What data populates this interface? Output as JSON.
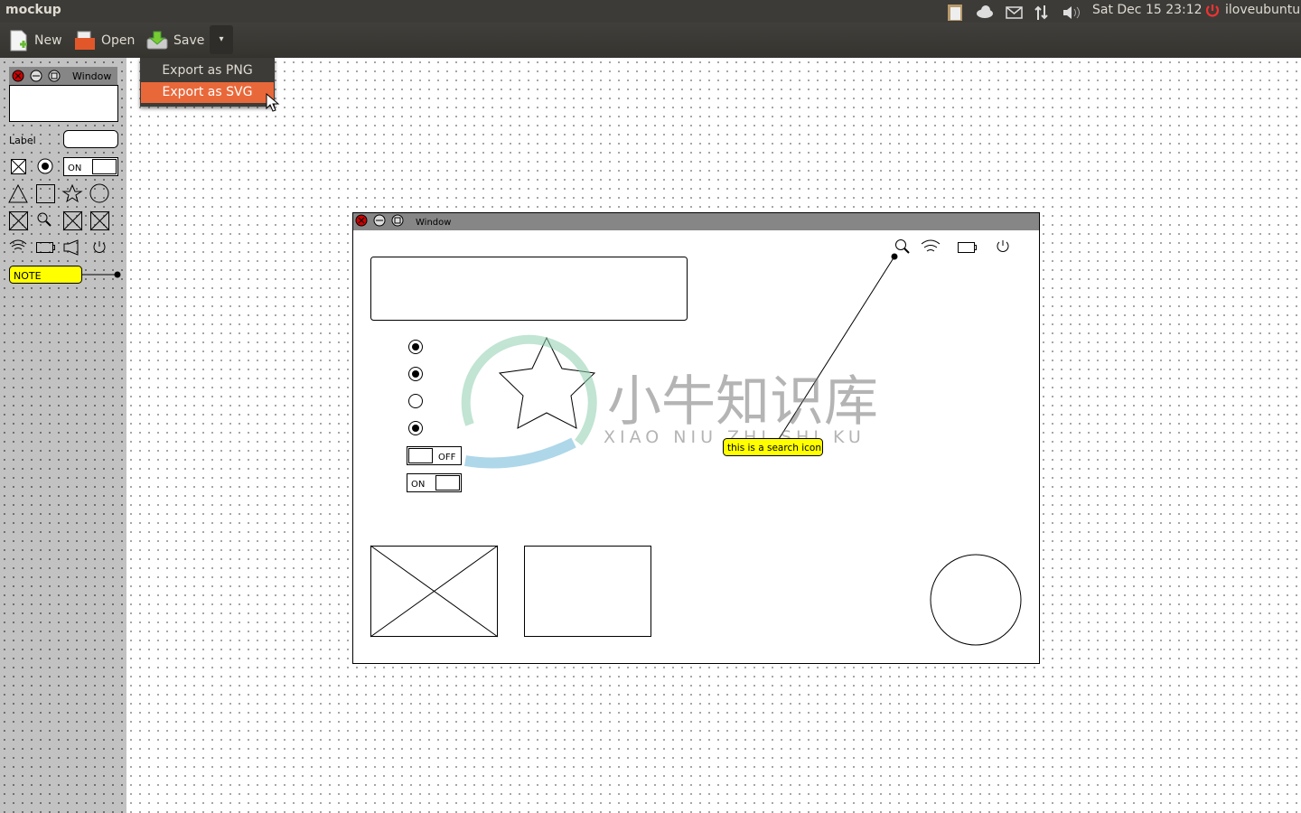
{
  "topbar": {
    "app_title": "mockup",
    "datetime": "Sat Dec 15  23:12",
    "user": "iloveubuntu",
    "icons": [
      "clipboard-icon",
      "cloud-icon",
      "mail-icon",
      "network-icon",
      "volume-icon",
      "power-icon"
    ]
  },
  "toolbar": {
    "new_label": "New",
    "open_label": "Open",
    "save_label": "Save",
    "dropdown_glyph": "▾"
  },
  "export_menu": {
    "items": [
      {
        "label": "Export as PNG"
      },
      {
        "label": "Export as SVG",
        "highlighted": true
      }
    ],
    "highlight_color": "#e9683a"
  },
  "palette": {
    "window_title": "Window",
    "label_text": "Label",
    "toggle_text": "ON",
    "note_text": "NOTE"
  },
  "mockup": {
    "window_title": "Window",
    "toggle_off": "OFF",
    "toggle_on": "ON",
    "note_text": "this is a search icon",
    "radios": [
      true,
      true,
      false,
      true
    ]
  },
  "watermark": {
    "text": "小牛知识库",
    "subtext": "XIAO NIU ZHI SHI KU"
  },
  "colors": {
    "note_yellow": "#ffff00",
    "close_red": "#cc0000",
    "panel_bg": "#3c3b37"
  }
}
